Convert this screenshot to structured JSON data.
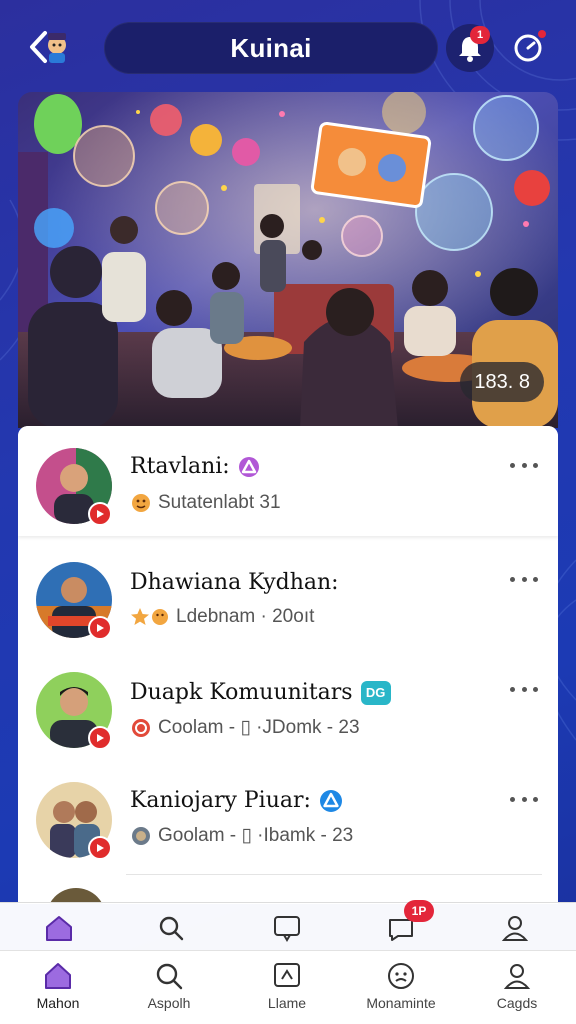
{
  "header": {
    "title": "Kuinai",
    "notification_count": "1"
  },
  "hero": {
    "image_alt": "group of people gathered in a lounge with floating avatar bubbles",
    "counter": "183. 8"
  },
  "list": {
    "items": [
      {
        "name": "Rtavlani:",
        "subtitle": "Sutatenlabt 31",
        "name_badge": "triangle-badge-purple",
        "sub_icon": "emoji-icon"
      },
      {
        "name": "Dhawiana Kydhan:",
        "subtitle": "Ldebnam · 20oıt",
        "name_badge": "",
        "sub_icon": "star-emoji-icon"
      },
      {
        "name": "Duapk Komuunitars",
        "subtitle": "Coolam - ▯ ·JDomk - 23",
        "name_badge": "DG",
        "sub_icon": "ring-icon"
      },
      {
        "name": "Kaniojary Piuar:",
        "subtitle": "Goolam - ▯ ·Ibamk - 23",
        "name_badge": "triangle-badge-blue",
        "sub_icon": "photo-icon"
      }
    ]
  },
  "ghost_nav": {
    "badge": "1P"
  },
  "bottom_nav": {
    "items": [
      {
        "label": "Mahon",
        "icon": "home-icon"
      },
      {
        "label": "Aspolh",
        "icon": "search-icon"
      },
      {
        "label": "Llame",
        "icon": "chat-icon"
      },
      {
        "label": "Monaminte",
        "icon": "face-icon"
      },
      {
        "label": "Cagds",
        "icon": "profile-icon"
      }
    ]
  },
  "colors": {
    "background": "#2338b0",
    "accent_purple": "#7b3fd0",
    "badge_red": "#e3263a"
  }
}
